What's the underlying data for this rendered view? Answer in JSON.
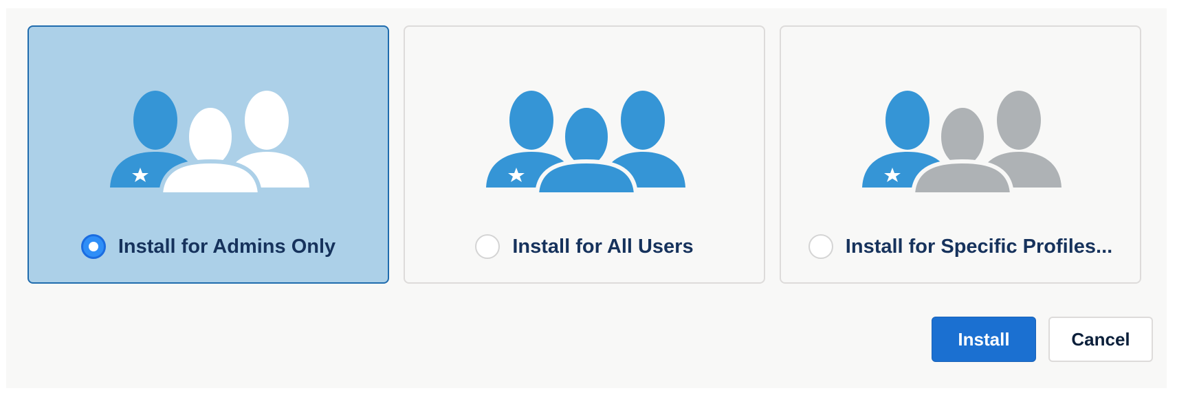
{
  "options": [
    {
      "label": "Install for Admins Only",
      "selected": true,
      "icon": "users-admin-only-icon"
    },
    {
      "label": "Install for All Users",
      "selected": false,
      "icon": "users-all-icon"
    },
    {
      "label": "Install for Specific Profiles...",
      "selected": false,
      "icon": "users-specific-profiles-icon"
    }
  ],
  "actions": {
    "install_label": "Install",
    "cancel_label": "Cancel"
  },
  "colors": {
    "accent": "#1b70d1",
    "icon_blue": "#3595d6",
    "icon_gray": "#aeb2b5",
    "selected_card": "#acd0e8",
    "label_text": "#16325c"
  }
}
